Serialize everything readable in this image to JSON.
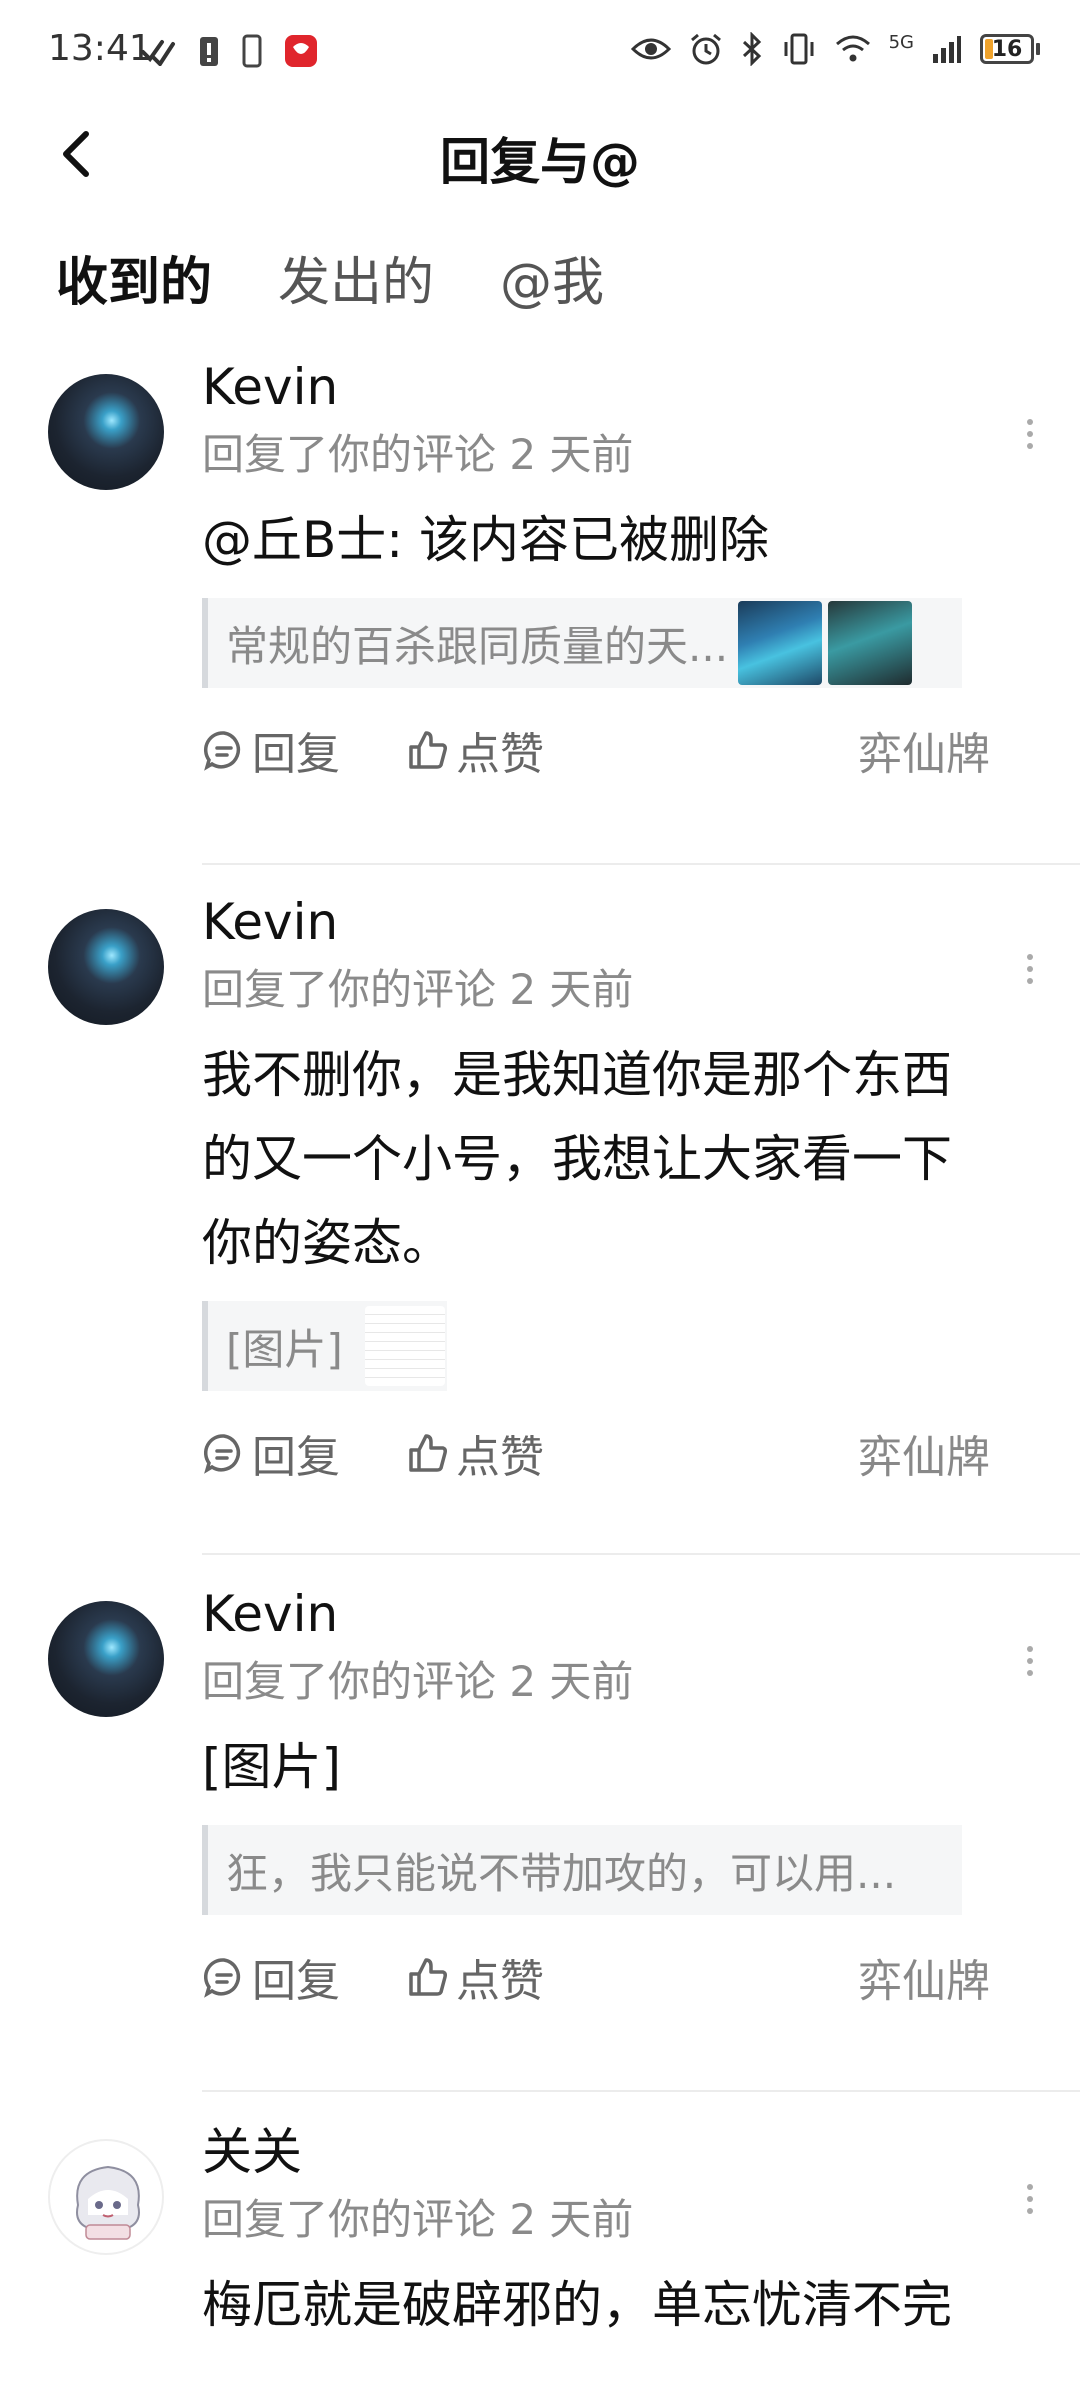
{
  "status_bar": {
    "time": "13:41",
    "network": "5G",
    "battery": "16",
    "battery_level": 0.16,
    "icons": [
      "status-check-icon",
      "status-alert-icon",
      "status-phone-icon",
      "status-app-icon",
      "eye-icon",
      "alarm-icon",
      "bluetooth-icon",
      "vibrate-icon",
      "wifi-icon",
      "signal-icon"
    ]
  },
  "nav": {
    "title": "回复与@"
  },
  "tabs": [
    {
      "label": "收到的",
      "active": true
    },
    {
      "label": "发出的",
      "active": false
    },
    {
      "label": "@我",
      "active": false
    }
  ],
  "comments": [
    {
      "user": "Kevin",
      "meta": "回复了你的评论 2 天前",
      "text": "@丘B士: 该内容已被删除",
      "quote": "常规的百杀跟同质量的天...",
      "reply_label": "回复",
      "like_label": "点赞",
      "channel": "弈仙牌"
    },
    {
      "user": "Kevin",
      "meta": "回复了你的评论 2 天前",
      "text_lines": [
        "我不删你，是我知道你是那个东西",
        "的又一个小号，我想让大家看一下",
        "你的姿态。"
      ],
      "quote": "[图片]",
      "reply_label": "回复",
      "like_label": "点赞",
      "channel": "弈仙牌"
    },
    {
      "user": "Kevin",
      "meta": "回复了你的评论 2 天前",
      "text": "[图片]",
      "quote": "狂，我只能说不带加攻的，可以用...",
      "reply_label": "回复",
      "like_label": "点赞",
      "channel": "弈仙牌"
    },
    {
      "user": "关关",
      "meta": "回复了你的评论 2 天前",
      "text": "梅厄就是破辟邪的，单忘忧清不完"
    }
  ],
  "colors": {
    "accent": "#25d0b6",
    "meta_gray": "#8a8a8a",
    "battery": "#f0a32c"
  }
}
